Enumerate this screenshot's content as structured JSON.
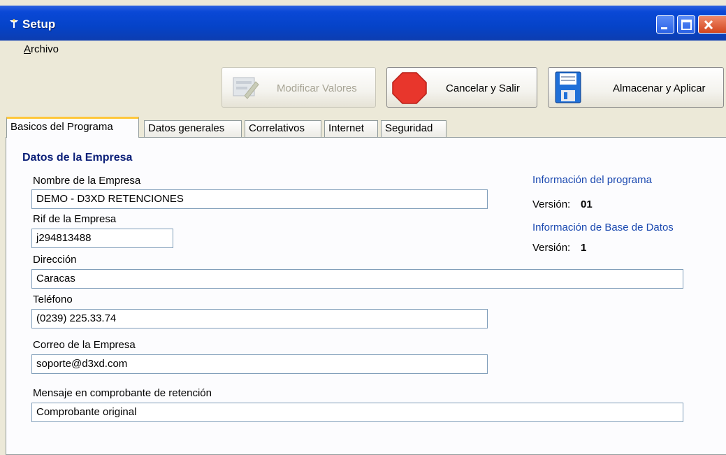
{
  "window": {
    "title": "Setup",
    "icon": "app-icon"
  },
  "menu": {
    "archivo_u": "A",
    "archivo_rest": "rchivo"
  },
  "toolbar": {
    "modificar": "Modificar Valores",
    "cancelar": "Cancelar y Salir",
    "almacenar": "Almacenar y Aplicar"
  },
  "tabs": [
    "Basicos del Programa",
    "Datos generales",
    "Correlativos",
    "Internet",
    "Seguridad"
  ],
  "form": {
    "section_title": "Datos de la Empresa",
    "nombre_label": "Nombre de la Empresa",
    "nombre_value": "DEMO - D3XD RETENCIONES",
    "rif_label": "Rif de la Empresa",
    "rif_value": "j294813488",
    "direccion_label": "Dirección",
    "direccion_value": "Caracas",
    "telefono_label": "Teléfono",
    "telefono_value": "(0239) 225.33.74",
    "correo_label": "Correo de la Empresa",
    "correo_value": "soporte@d3xd.com",
    "mensaje_label": "Mensaje en comprobante de retención",
    "mensaje_value": "Comprobante original"
  },
  "info": {
    "programa_title": "Información del programa",
    "programa_version_label": "Versión:",
    "programa_version": "01",
    "bd_title": "Información de Base de Datos",
    "bd_version_label": "Versión:",
    "bd_version": "1"
  },
  "colors": {
    "titlebar": "#0543c8",
    "section_title": "#0b1f78",
    "info_heading": "#1b49b0",
    "active_tab_accent": "#ffc83c"
  }
}
